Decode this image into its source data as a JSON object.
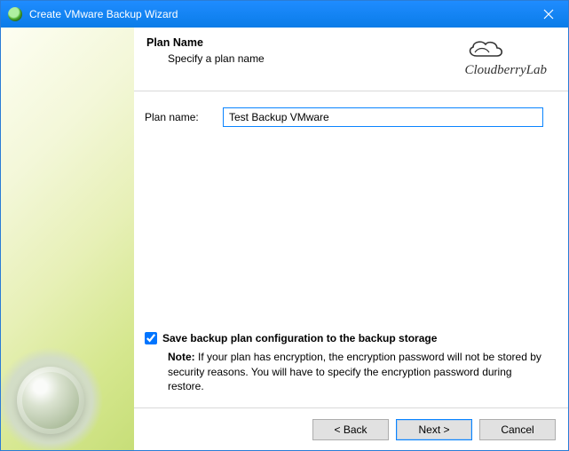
{
  "window": {
    "title": "Create VMware Backup Wizard"
  },
  "brand": {
    "name": "CloudberryLab"
  },
  "header": {
    "title": "Plan Name",
    "subtitle": "Specify a plan name"
  },
  "form": {
    "plan_name_label": "Plan name:",
    "plan_name_value": "Test Backup VMware",
    "save_config_checked": true,
    "save_config_label": "Save backup plan configuration to the backup storage",
    "note_prefix": "Note:",
    "note_text": "If your plan has encryption, the encryption password will not be stored by security reasons. You will have to specify the encryption password during restore."
  },
  "buttons": {
    "back": "< Back",
    "next": "Next >",
    "cancel": "Cancel"
  }
}
